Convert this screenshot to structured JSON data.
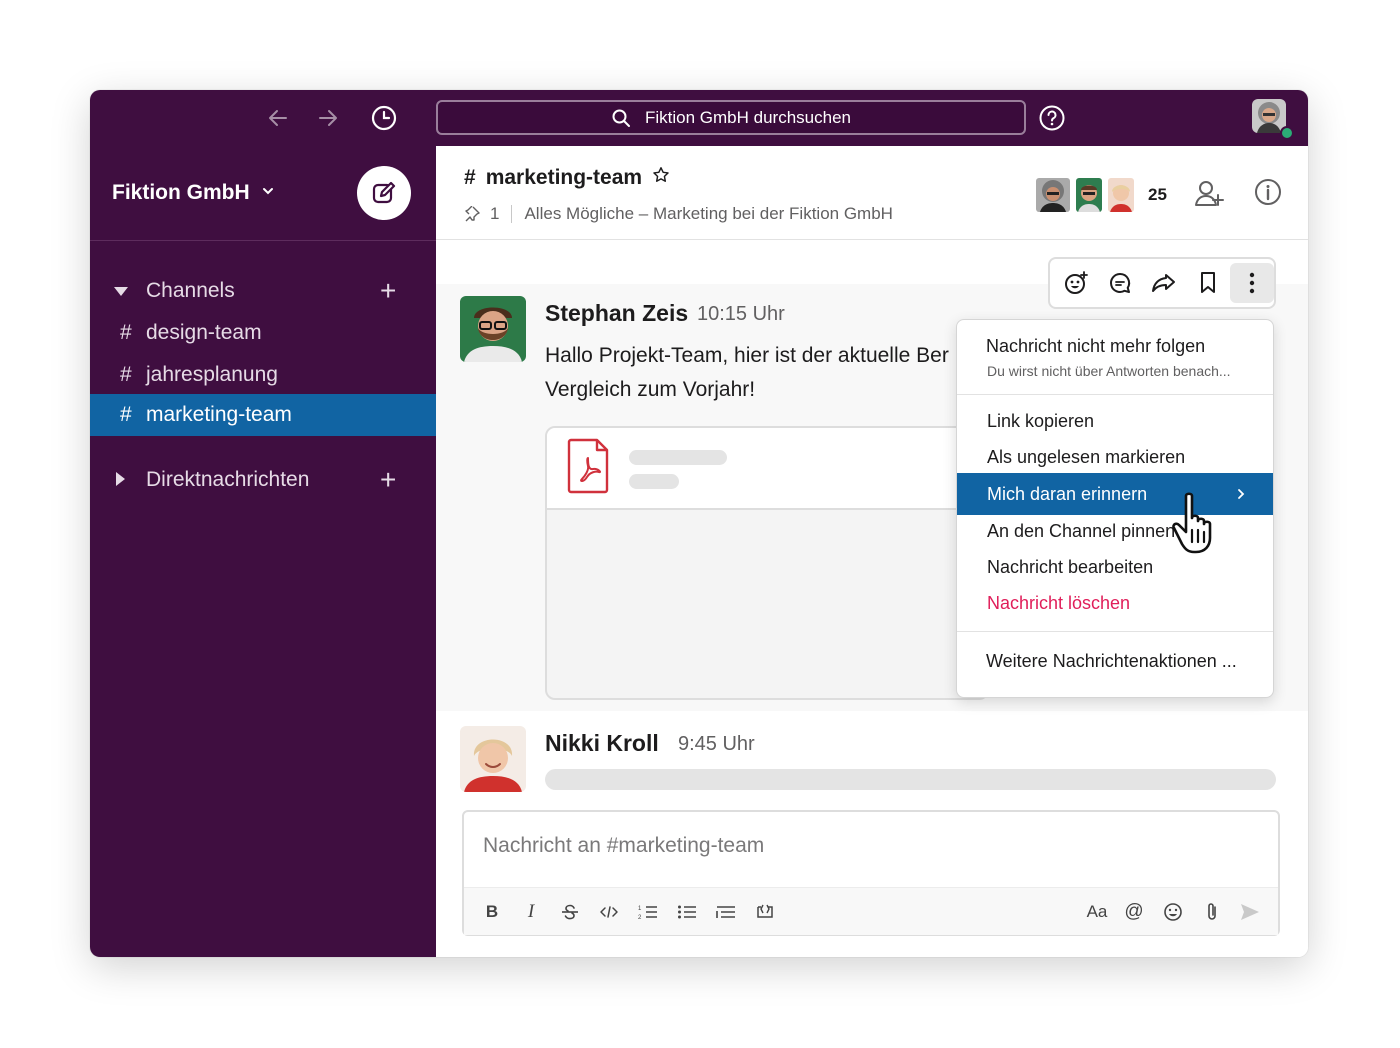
{
  "topbar": {
    "search_placeholder": "Fiktion GmbH durchsuchen"
  },
  "sidebar": {
    "workspace_name": "Fiktion GmbH",
    "channels_section": "Channels",
    "channels": [
      {
        "name": "design-team",
        "active": false
      },
      {
        "name": "jahresplanung",
        "active": false
      },
      {
        "name": "marketing-team",
        "active": true
      }
    ],
    "dm_section": "Direktnachrichten"
  },
  "channel": {
    "hash": "#",
    "name": "marketing-team",
    "pinned_count": "1",
    "topic": "Alles Mögliche – Marketing bei der Fiktion GmbH",
    "member_count": "25"
  },
  "messages": [
    {
      "author": "Stephan Zeis",
      "time": "10:15 Uhr",
      "text": "Hallo Projekt-Team, hier ist der aktuelle Ber",
      "text_line2": "Vergleich zum Vorjahr!"
    },
    {
      "author": "Nikki Kroll",
      "time": "9:45 Uhr"
    }
  ],
  "context_menu": {
    "unfollow_title": "Nachricht nicht mehr folgen",
    "unfollow_sub": "Du wirst nicht über Antworten benach...",
    "copy_link": "Link kopieren",
    "mark_unread": "Als ungelesen markieren",
    "remind": "Mich daran erinnern",
    "pin": "An den Channel pinnen",
    "edit": "Nachricht bearbeiten",
    "delete": "Nachricht löschen",
    "more": "Weitere Nachrichtenaktionen ...",
    "delete_color": "#e01e5a"
  },
  "composer": {
    "placeholder": "Nachricht an #marketing-team",
    "format_label": "Aa"
  },
  "colors": {
    "aubergine": "#3f0e40",
    "active_blue": "#1164a3",
    "pdf_red": "#d0313c"
  }
}
